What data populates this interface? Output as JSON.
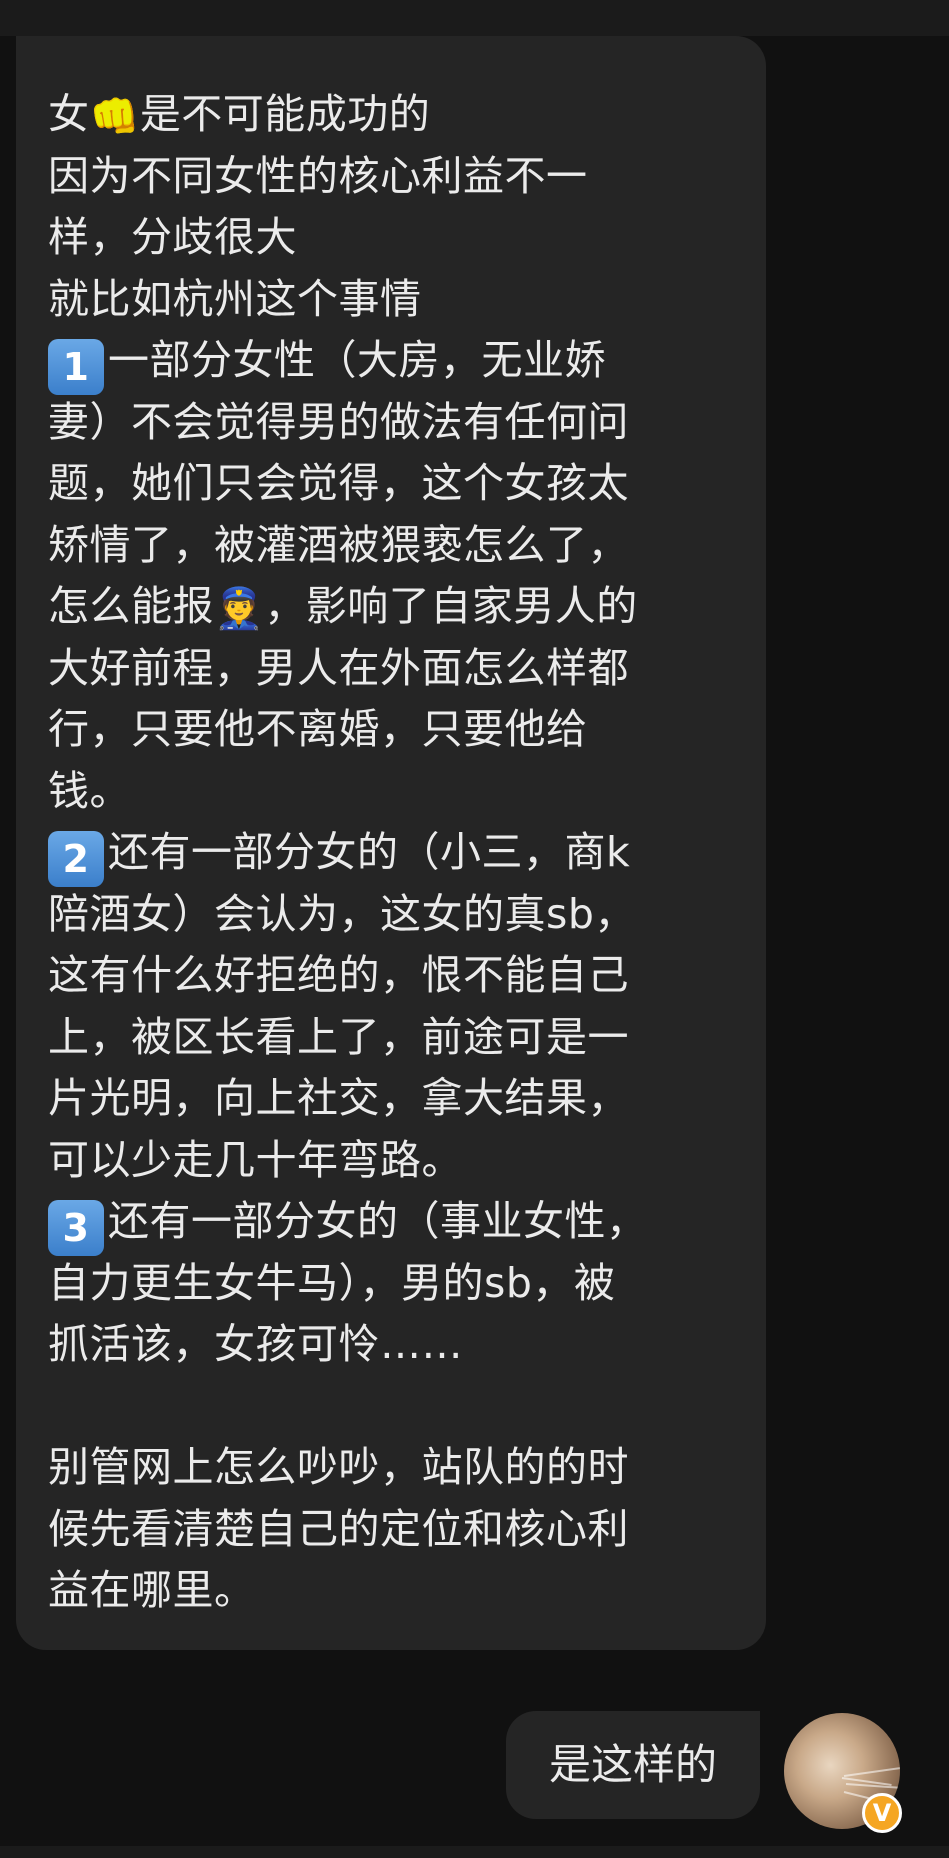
{
  "incoming_message": {
    "lines": [
      {
        "prefix": "女",
        "emoji": "👊",
        "text": "是不可能成功的"
      },
      {
        "text": "因为不同女性的核心利益不一"
      },
      {
        "text": "样，分歧很大"
      },
      {
        "text": "就比如杭州这个事情"
      },
      {
        "badge": "1",
        "text": "一部分女性（大房，无业娇"
      },
      {
        "text": "妻）不会觉得男的做法有任何问"
      },
      {
        "text": "题，她们只会觉得，这个女孩太"
      },
      {
        "text": "矫情了，被灌酒被猥亵怎么了，"
      },
      {
        "prefix": "怎么能报",
        "emoji": "👮",
        "text": "，影响了自家男人的"
      },
      {
        "text": "大好前程，男人在外面怎么样都"
      },
      {
        "text": "行，只要他不离婚，只要他给"
      },
      {
        "text": "钱。"
      },
      {
        "badge": "2",
        "text": "还有一部分女的（小三，商k"
      },
      {
        "text": "陪酒女）会认为，这女的真sb，"
      },
      {
        "text": "这有什么好拒绝的，恨不能自己"
      },
      {
        "text": "上，被区长看上了，前途可是一"
      },
      {
        "text": "片光明，向上社交，拿大结果，"
      },
      {
        "text": "可以少走几十年弯路。"
      },
      {
        "badge": "3",
        "text": "还有一部分女的（事业女性，"
      },
      {
        "text": "自力更生女牛马），男的sb，被"
      },
      {
        "text": "抓活该，女孩可怜……"
      },
      {
        "text": ""
      },
      {
        "text": "别管网上怎么吵吵，站队的的时"
      },
      {
        "text": "候先看清楚自己的定位和核心利"
      },
      {
        "text": "益在哪里。"
      }
    ]
  },
  "outgoing_message": {
    "text": "是这样的"
  },
  "avatar": {
    "badge_label": "V",
    "badge_color": "#f5a623"
  },
  "colors": {
    "background": "#111111",
    "bubble": "#252525",
    "text": "#ebebeb",
    "keycap": "#4a8ed6"
  },
  "icons": {
    "fist": "oncoming-fist-emoji",
    "police": "police-officer-emoji",
    "keycap": "keycap-number-emoji"
  }
}
